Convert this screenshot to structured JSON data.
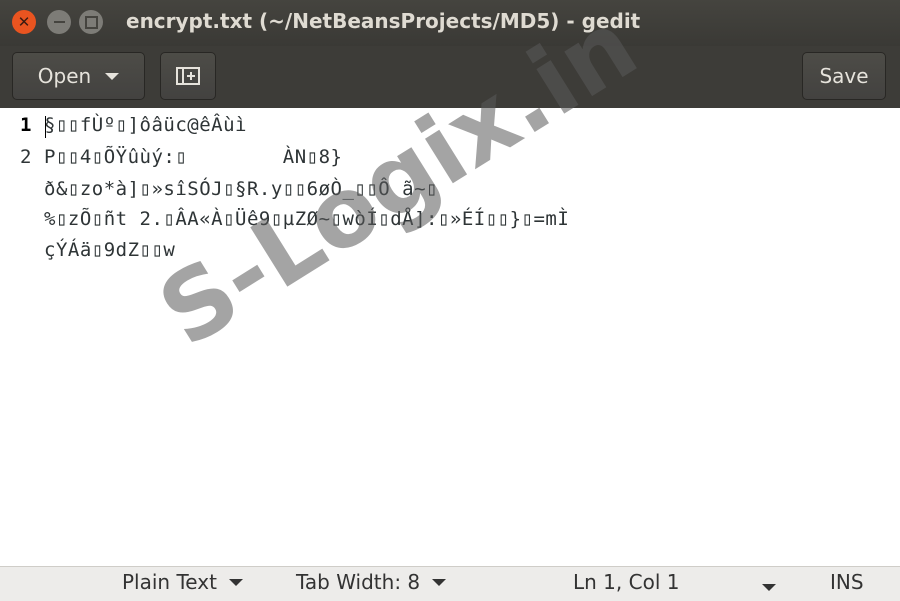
{
  "window": {
    "title": "encrypt.txt (~/NetBeansProjects/MD5) - gedit"
  },
  "toolbar": {
    "open_label": "Open",
    "save_label": "Save"
  },
  "editor": {
    "line_numbers": [
      "1",
      "2"
    ],
    "lines": [
      "§▯▯fÙº▯]ôâüc@êÂùì",
      "P▯▯4▯ÕŸûùý:▯        ÀN▯8}",
      "ð&▯zo*à]▯»sîSÓJ▯§R.y▯▯6øÒ_▯▯Ô ã~▯",
      "%▯zÕ▯ñt 2.▯ÂA«À▯Üê9▯µZØ~▯wòÍ▯dÅ]:▯»ÉÍ▯▯}▯=mÌ",
      "çÝÁä▯9dZ▯▯w"
    ]
  },
  "watermark": {
    "text": "S-Logix.in"
  },
  "statusbar": {
    "language": "Plain Text",
    "tab_width": "Tab Width: 8",
    "position": "Ln 1, Col 1",
    "mode": "INS"
  }
}
